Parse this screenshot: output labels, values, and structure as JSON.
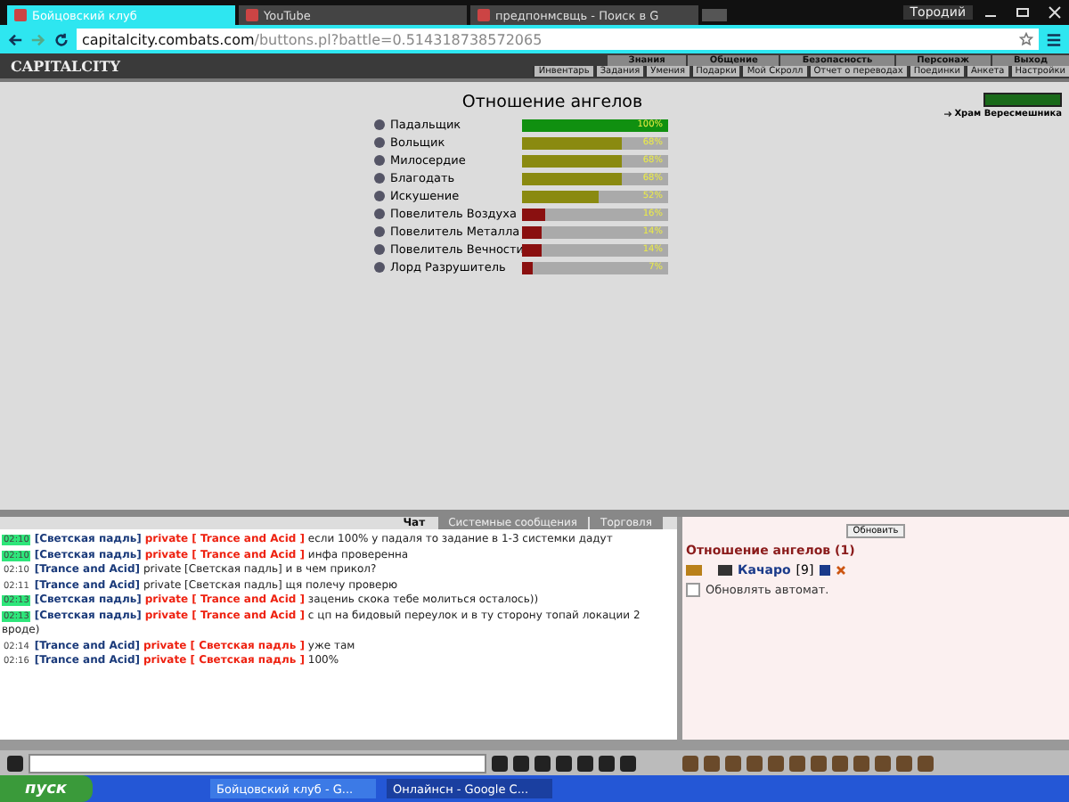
{
  "browser": {
    "tabs": [
      {
        "title": "Бойцовский клуб",
        "selected": true
      },
      {
        "title": "YouTube",
        "selected": false
      },
      {
        "title": "предпонмсвщь - Поиск в G",
        "selected": false
      }
    ],
    "user": "Тородий",
    "url_host": "capitalcity.combats.com",
    "url_path": "/buttons.pl?battle=0.514318738572065"
  },
  "game": {
    "logo": "CAPITALCITY",
    "top_menu": [
      "Знания",
      "Общение",
      "Безопасность",
      "Персонаж",
      "Выход"
    ],
    "sub_menu": [
      "Инвентарь",
      "Задания",
      "Умения",
      "Подарки",
      "Мой Скролл",
      "Отчет о переводах",
      "Поединки",
      "Анкета",
      "Настройки"
    ],
    "location_link": "Храм Вересмешника"
  },
  "relations": {
    "title": "Отношение ангелов",
    "rows": [
      {
        "name": "Падальщик",
        "level": 1.0,
        "reading": "100%",
        "color": "#109010"
      },
      {
        "name": "Вольщик",
        "level": 0.68,
        "reading": "68%",
        "color": "#8a8a10"
      },
      {
        "name": "Милосердие",
        "level": 0.68,
        "reading": "68%",
        "color": "#8a8a10"
      },
      {
        "name": "Благодать",
        "level": 0.68,
        "reading": "68%",
        "color": "#8a8a10"
      },
      {
        "name": "Искушение",
        "level": 0.52,
        "reading": "52%",
        "color": "#8a8a10"
      },
      {
        "name": "Повелитель Воздуха",
        "level": 0.16,
        "reading": "16%",
        "color": "#8a1010"
      },
      {
        "name": "Повелитель Металла",
        "level": 0.14,
        "reading": "14%",
        "color": "#8a1010"
      },
      {
        "name": "Повелитель Вечности",
        "level": 0.14,
        "reading": "14%",
        "color": "#8a1010"
      },
      {
        "name": "Лорд Разрушитель",
        "level": 0.07,
        "reading": "7%",
        "color": "#8a1010"
      }
    ]
  },
  "chat_tabs": [
    {
      "label": "Чат",
      "selected": true
    },
    {
      "label": "Системные сообщения",
      "selected": false
    },
    {
      "label": "Торговля",
      "selected": false
    }
  ],
  "chat": [
    {
      "kind": "outgoing",
      "time": "02:10",
      "highlighted": true,
      "from": "[Светская падль]",
      "channel": "private",
      "to": "[ Trance and Acid ]",
      "text": "если 100% у падаля то задание в 1-3 системки дадут"
    },
    {
      "kind": "outgoing",
      "time": "02:10",
      "highlighted": true,
      "from": "[Светская падль]",
      "channel": "private",
      "to": "[ Trance and Acid ]",
      "text": "инфа проверенна"
    },
    {
      "kind": "incoming",
      "time": "02:10",
      "highlighted": false,
      "from": "[Trance and Acid]",
      "channel": "private",
      "to": "[Светская падль]",
      "text": "и в чем прикол?"
    },
    {
      "kind": "incoming",
      "time": "02:11",
      "highlighted": false,
      "from": "[Trance and Acid]",
      "channel": "private",
      "to": "[Светская падль]",
      "text": "щя полечу проверю"
    },
    {
      "kind": "outgoing",
      "time": "02:13",
      "highlighted": true,
      "from": "[Светская падль]",
      "channel": "private",
      "to": "[ Trance and Acid ]",
      "text": "зацениь скока тебе молиться осталось))"
    },
    {
      "kind": "outgoing",
      "time": "02:13",
      "highlighted": true,
      "from": "[Светская падль]",
      "channel": "private",
      "to": "[ Trance and Acid ]",
      "text": "с цп на бидовый переулок и в ту сторону топай локации 2 вроде)"
    },
    {
      "kind": "outgoing",
      "time": "02:14",
      "highlighted": false,
      "from": "[Trance and Acid]",
      "channel": "private",
      "to": "[ Светская падль ]",
      "text": "уже там"
    },
    {
      "kind": "outgoing",
      "time": "02:16",
      "highlighted": false,
      "from": "[Trance and Acid]",
      "channel": "private",
      "to": "[ Светская падль ]",
      "text": "100%"
    }
  ],
  "side": {
    "refresh_button": "Обновить",
    "title": "Отношение ангелов (1)",
    "player": "Качаро",
    "player_level": "[9]",
    "auto_refresh": {
      "label": "Обновлять автомат.",
      "checked": false
    }
  },
  "taskbar": {
    "start": "пуск",
    "items": [
      {
        "title": "Бойцовский клуб - G...",
        "selected": false
      },
      {
        "title": "Онлайнсн - Google C...",
        "selected": true
      }
    ]
  }
}
